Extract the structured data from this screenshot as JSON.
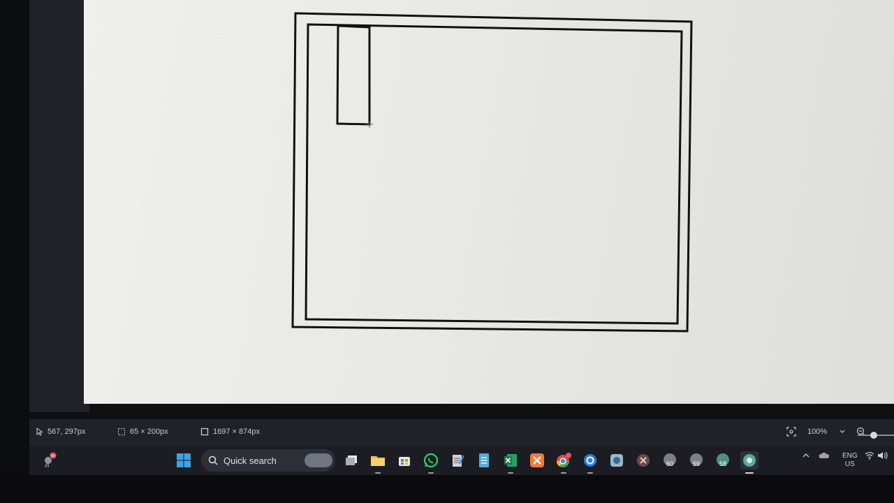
{
  "statusbar": {
    "cursor_position": "567, 297px",
    "selection_size": "65 × 200px",
    "canvas_size": "1697 × 874px",
    "zoom": "100%"
  },
  "taskbar": {
    "search_placeholder": "Quick search",
    "weather_badge": "9+",
    "apps": [
      {
        "name": "start",
        "icon": "windows-logo"
      },
      {
        "name": "task-view",
        "icon": "task-view-icon"
      },
      {
        "name": "file-explorer",
        "icon": "folder-icon"
      },
      {
        "name": "microsoft-store",
        "icon": "store-icon"
      },
      {
        "name": "whatsapp",
        "icon": "whatsapp-icon"
      },
      {
        "name": "notepad",
        "icon": "notepad-icon"
      },
      {
        "name": "docs",
        "icon": "document-icon"
      },
      {
        "name": "excel",
        "icon": "excel-icon"
      },
      {
        "name": "xampp",
        "icon": "xampp-icon"
      },
      {
        "name": "chrome",
        "icon": "chrome-icon"
      },
      {
        "name": "browser",
        "icon": "browser-icon"
      },
      {
        "name": "app",
        "icon": "app-icon"
      },
      {
        "name": "close-app",
        "icon": "x-icon"
      }
    ],
    "badges": {
      "b1": "60",
      "b2": "59",
      "b3": "58"
    }
  },
  "tray": {
    "lang_top": "ENG",
    "lang_bottom": "US"
  },
  "colors": {
    "accent": "#2d7be5",
    "excel": "#1d7a45",
    "whatsapp": "#25d366",
    "xampp": "#f07a3a"
  }
}
